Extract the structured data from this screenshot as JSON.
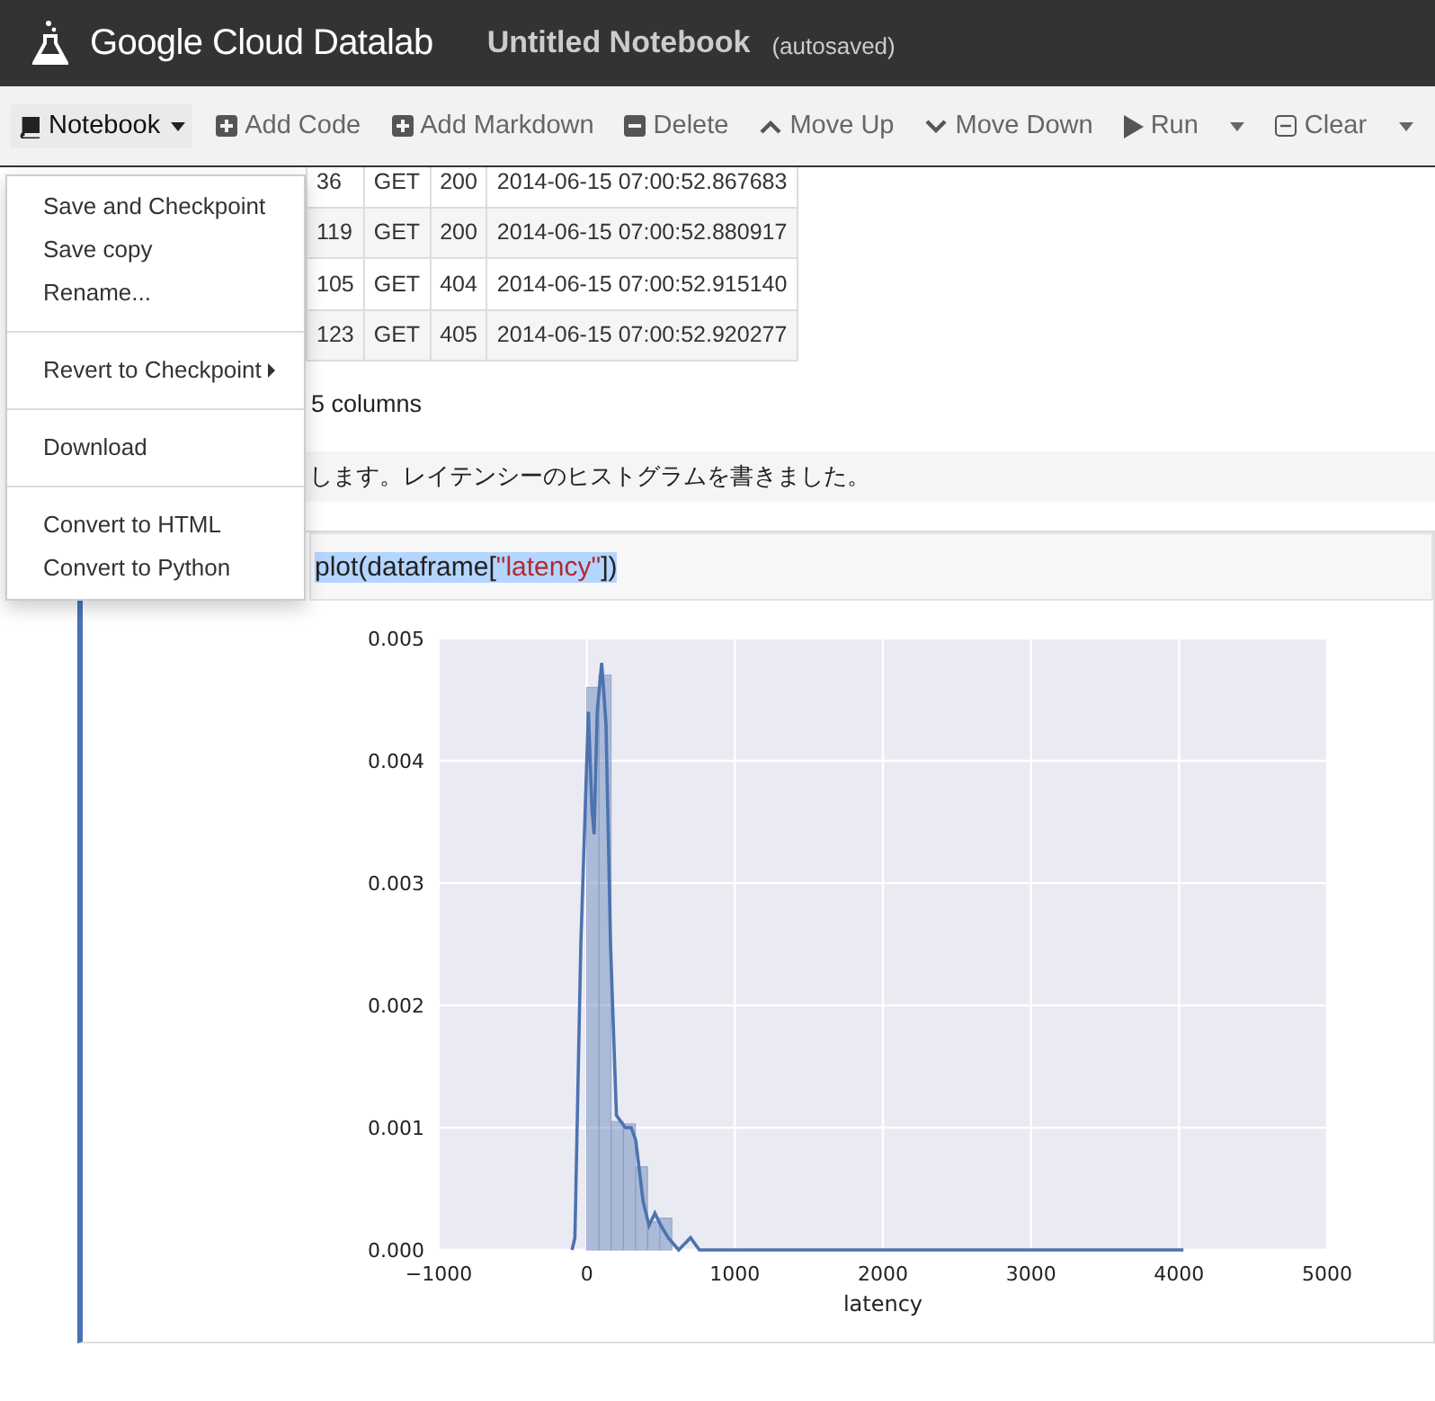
{
  "header": {
    "brand": "Google Cloud Datalab",
    "title": "Untitled Notebook",
    "status": "(autosaved)"
  },
  "toolbar": [
    {
      "kind": "menu",
      "label": "Notebook",
      "caret": true,
      "selected": true
    },
    {
      "kind": "button",
      "label": "Add Code",
      "caret": false,
      "selected": false
    },
    {
      "kind": "button",
      "label": "Add Markdown",
      "caret": false,
      "selected": false
    },
    {
      "kind": "button",
      "label": "Delete",
      "caret": false,
      "selected": false
    },
    {
      "kind": "button",
      "label": "Move Up",
      "caret": false,
      "selected": false
    },
    {
      "kind": "button",
      "label": "Move Down",
      "caret": false,
      "selected": false
    },
    {
      "kind": "button",
      "label": "Run",
      "caret": true,
      "selected": false
    },
    {
      "kind": "button",
      "label": "Clear",
      "caret": true,
      "selected": false
    }
  ],
  "menu": [
    {
      "kind": "item",
      "label": "Save and Checkpoint",
      "submenu": false
    },
    {
      "kind": "item",
      "label": "Save copy",
      "submenu": false
    },
    {
      "kind": "item",
      "label": "Rename...",
      "submenu": false
    },
    {
      "kind": "divider"
    },
    {
      "kind": "item",
      "label": "Revert to Checkpoint",
      "submenu": true
    },
    {
      "kind": "divider"
    },
    {
      "kind": "item",
      "label": "Download",
      "submenu": false
    },
    {
      "kind": "divider"
    },
    {
      "kind": "item",
      "label": "Convert to HTML",
      "submenu": false
    },
    {
      "kind": "item",
      "label": "Convert to Python",
      "submenu": false
    }
  ],
  "table": {
    "rows": [
      [
        "36",
        "GET",
        "200",
        "2014-06-15 07:00:52.867683"
      ],
      [
        "119",
        "GET",
        "200",
        "2014-06-15 07:00:52.880917"
      ],
      [
        "105",
        "GET",
        "404",
        "2014-06-15 07:00:52.915140"
      ],
      [
        "123",
        "GET",
        "405",
        "2014-06-15 07:00:52.920277"
      ]
    ],
    "footer": "5 columns"
  },
  "markdown": "します。レイテンシーのヒストグラムを書きました。",
  "code": [
    {
      "kind": "plain",
      "text": "plot(dataframe["
    },
    {
      "kind": "string",
      "text": "\"latency\""
    },
    {
      "kind": "plain",
      "text": "])"
    }
  ],
  "histogram": {
    "chart_data": {
      "type": "bar",
      "xlabel": "latency",
      "grid": true,
      "x": [
        41,
        123,
        205,
        287,
        369,
        451,
        533
      ],
      "values": [
        0.0046,
        0.0047,
        0.00105,
        0.00103,
        0.00068,
        0.00023,
        0.00026
      ],
      "xlim": [
        -1000,
        5000
      ],
      "ylim": [
        0,
        0.005
      ],
      "xticks": [
        {
          "value": -1000,
          "label": "−1000"
        },
        {
          "value": 0,
          "label": "0"
        },
        {
          "value": 1000,
          "label": "1000"
        },
        {
          "value": 2000,
          "label": "2000"
        },
        {
          "value": 3000,
          "label": "3000"
        },
        {
          "value": 4000,
          "label": "4000"
        },
        {
          "value": 5000,
          "label": "5000"
        }
      ],
      "yticks": [
        {
          "value": 0,
          "label": "0.000"
        },
        {
          "value": 0.001,
          "label": "0.001"
        },
        {
          "value": 0.002,
          "label": "0.002"
        },
        {
          "value": 0.003,
          "label": "0.003"
        },
        {
          "value": 0.004,
          "label": "0.004"
        },
        {
          "value": 0.005,
          "label": "0.005"
        }
      ]
    }
  },
  "density": {
    "chart_data": {
      "type": "line",
      "xlim": [
        -1000,
        5000
      ],
      "ylim": [
        0,
        0.005
      ],
      "x": [
        -100,
        -80,
        -40,
        10,
        35,
        50,
        70,
        100,
        130,
        160,
        200,
        260,
        300,
        330,
        380,
        420,
        460,
        500,
        550,
        620,
        700,
        760,
        1000,
        1200,
        1300,
        1400,
        1900,
        1950,
        2000,
        3900,
        3950,
        4030
      ],
      "series": [
        {
          "color": "#4c72b0",
          "values": [
            0,
            0.0001,
            0.0025,
            0.0044,
            0.0036,
            0.0034,
            0.0044,
            0.0048,
            0.0043,
            0.0025,
            0.0011,
            0.001,
            0.001,
            0.0009,
            0.0004,
            0.0002,
            0.0003,
            0.0002,
            0.0001,
            0,
            0.0001,
            0,
            0,
            0,
            0,
            0,
            0,
            0,
            0,
            0,
            0,
            0
          ]
        }
      ]
    }
  }
}
